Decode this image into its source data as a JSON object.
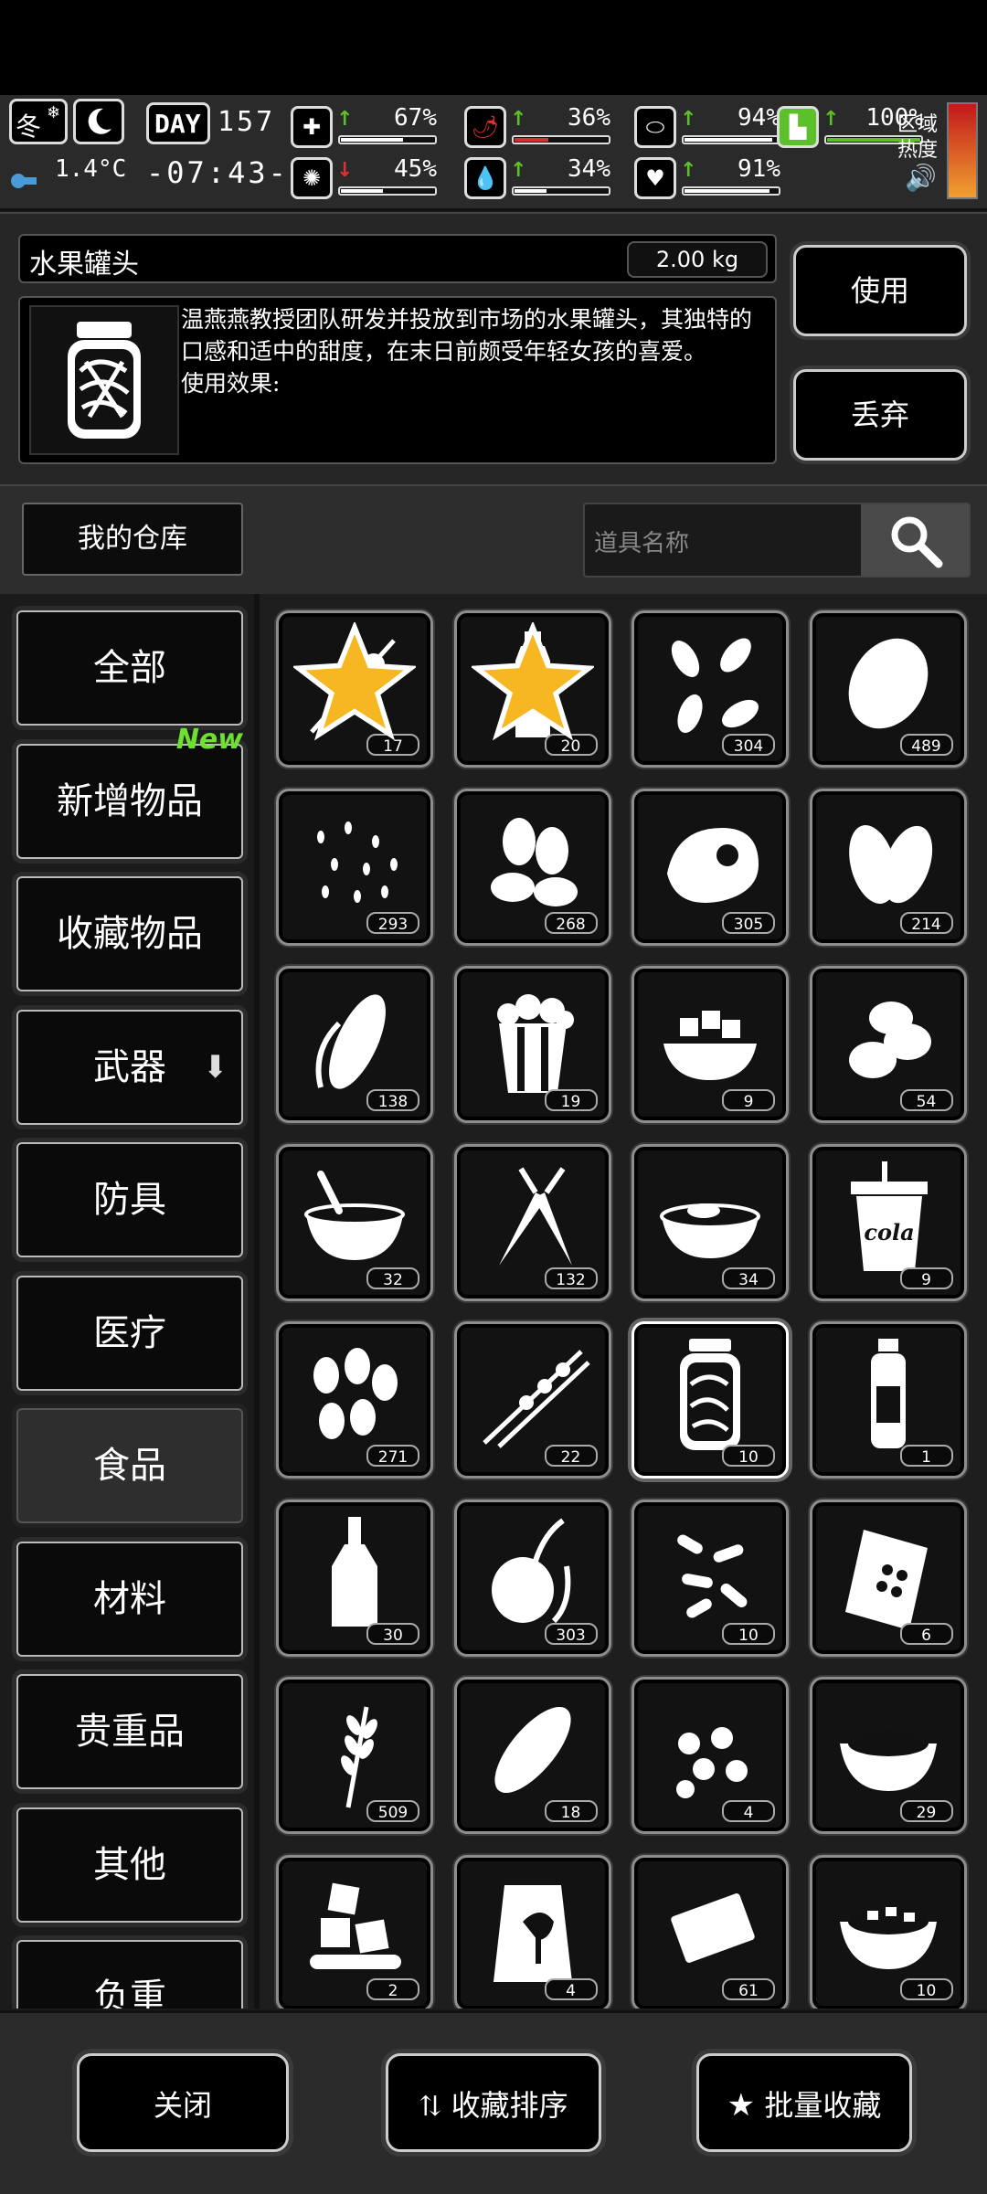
{
  "hud": {
    "season": "冬",
    "temperature": "1.4°C",
    "day_label": "DAY",
    "day_number": "157",
    "time": "-07:43-",
    "zone_label_1": "区域",
    "zone_label_2": "热度",
    "stats": [
      {
        "name": "health",
        "icon": "medkit-icon",
        "arrow": "↑",
        "value": "67%",
        "level": 0.67,
        "bar_color": "#ffffff"
      },
      {
        "name": "hunger",
        "icon": "pepper-icon",
        "arrow": "↑",
        "value": "36%",
        "level": 0.36,
        "bar_color": "#d23030"
      },
      {
        "name": "satiety",
        "icon": "capsule-icon",
        "arrow": "↑",
        "value": "94%",
        "level": 0.94,
        "bar_color": "#ffffff"
      },
      {
        "name": "stamina",
        "icon": "boot-icon",
        "arrow": "↑",
        "value": "100%",
        "level": 1.0,
        "bar_color": "#5cc02a"
      },
      {
        "name": "brain",
        "icon": "brain-icon",
        "arrow": "↓",
        "value": "45%",
        "level": 0.45,
        "bar_color": "#ffffff"
      },
      {
        "name": "thirst",
        "icon": "water-drop-icon",
        "arrow": "↑",
        "value": "34%",
        "level": 0.34,
        "bar_color": "#ffffff"
      },
      {
        "name": "mood",
        "icon": "heart-icon",
        "arrow": "↑",
        "value": "91%",
        "level": 0.91,
        "bar_color": "#ffffff"
      }
    ],
    "colors": {
      "up": "#5cc02a",
      "down": "#e23030",
      "heat_top": "#c2181b",
      "heat_bottom": "#f0a030"
    }
  },
  "item": {
    "name": "水果罐头",
    "weight": "2.00 kg",
    "description": "温燕燕教授团队研发并投放到市场的水果罐头，其独特的口感和适中的甜度，在末日前颇受年轻女孩的喜爱。\n使用效果:\n ",
    "use_label": "使用",
    "discard_label": "丢弃"
  },
  "warehouse": {
    "title": "我的仓库",
    "search_placeholder": "道具名称"
  },
  "categories": [
    {
      "label": "全部",
      "active": false
    },
    {
      "label": "新增物品",
      "active": false,
      "badge": "New"
    },
    {
      "label": "收藏物品",
      "active": false
    },
    {
      "label": "武器",
      "active": false,
      "dropdown": true
    },
    {
      "label": "防具",
      "active": false
    },
    {
      "label": "医疗",
      "active": false
    },
    {
      "label": "食品",
      "active": true
    },
    {
      "label": "材料",
      "active": false
    },
    {
      "label": "贵重品",
      "active": false
    },
    {
      "label": "其他",
      "active": false
    },
    {
      "label": "负重",
      "active": false
    }
  ],
  "items": [
    {
      "icon": "skewer-icon",
      "count": "17",
      "favorite": true
    },
    {
      "icon": "water-bottle-icon",
      "count": "20",
      "favorite": true
    },
    {
      "icon": "seeds-icon",
      "count": "304"
    },
    {
      "icon": "potato-icon",
      "count": "489"
    },
    {
      "icon": "rice-icon",
      "count": "293"
    },
    {
      "icon": "almonds-icon",
      "count": "268"
    },
    {
      "icon": "meat-icon",
      "count": "305"
    },
    {
      "icon": "pistachio-icon",
      "count": "214"
    },
    {
      "icon": "corn-icon",
      "count": "138"
    },
    {
      "icon": "popcorn-icon",
      "count": "19"
    },
    {
      "icon": "tofu-bowl-icon",
      "count": "9"
    },
    {
      "icon": "beans-icon",
      "count": "54"
    },
    {
      "icon": "soup-bowl-icon",
      "count": "32"
    },
    {
      "icon": "carrot-icon",
      "count": "132"
    },
    {
      "icon": "porridge-icon",
      "count": "34"
    },
    {
      "icon": "cola-cup-icon",
      "count": "9",
      "label": "cola"
    },
    {
      "icon": "nuts-icon",
      "count": "271"
    },
    {
      "icon": "kebab-icon",
      "count": "22"
    },
    {
      "icon": "fruit-can-icon",
      "count": "10",
      "selected": true
    },
    {
      "icon": "sauce-bottle-icon",
      "count": "1"
    },
    {
      "icon": "liquor-bottle-icon",
      "count": "30"
    },
    {
      "icon": "radish-icon",
      "count": "303"
    },
    {
      "icon": "dog-biscuit-icon",
      "count": "10"
    },
    {
      "icon": "snack-bag-icon",
      "count": "6"
    },
    {
      "icon": "wheat-icon",
      "count": "509"
    },
    {
      "icon": "bread-icon",
      "count": "18"
    },
    {
      "icon": "berries-icon",
      "count": "4"
    },
    {
      "icon": "stew-icon",
      "count": "29"
    },
    {
      "icon": "ice-cubes-icon",
      "count": "2"
    },
    {
      "icon": "ham-bag-icon",
      "count": "4"
    },
    {
      "icon": "chocolate-bar-icon",
      "count": "61"
    },
    {
      "icon": "hotpot-icon",
      "count": "10"
    }
  ],
  "bottom": {
    "close_label": "关闭",
    "sort_label": "收藏排序",
    "batch_label": "批量收藏"
  }
}
